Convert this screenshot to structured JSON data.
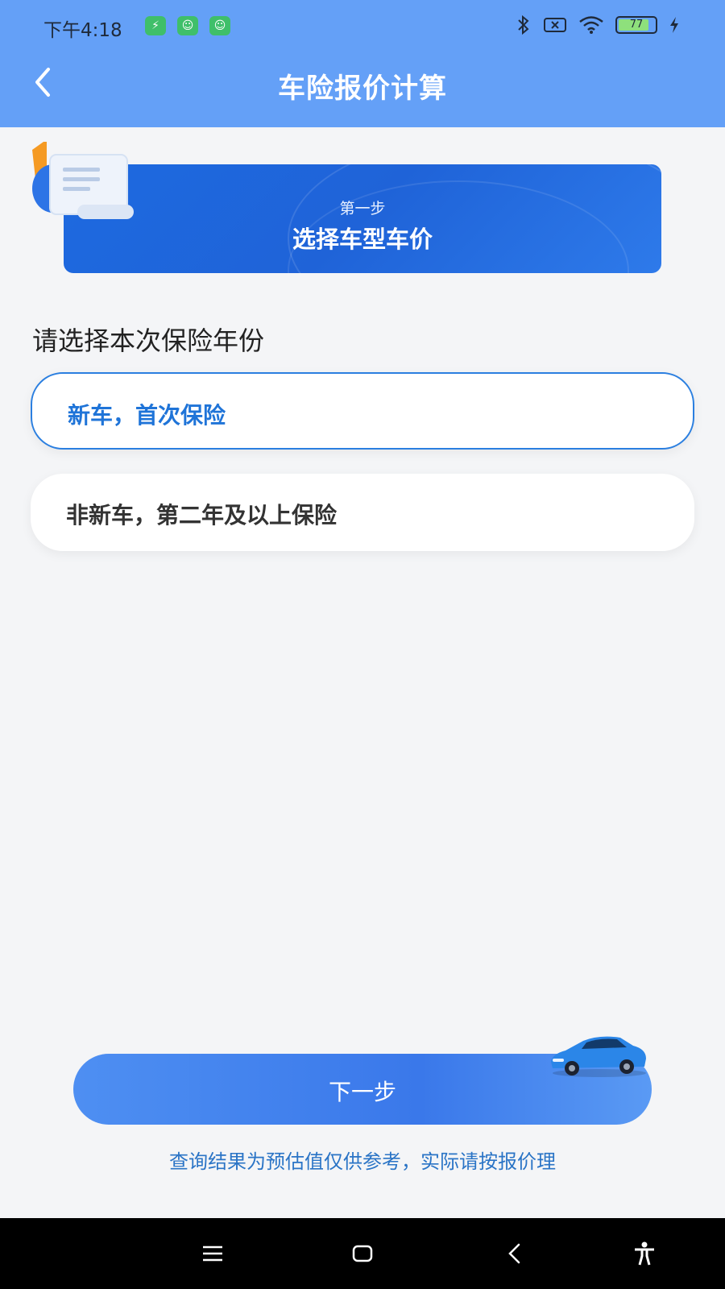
{
  "status_bar": {
    "time": "下午4:18",
    "battery": "77"
  },
  "header": {
    "title": "车险报价计算"
  },
  "step": {
    "label": "第一步",
    "title": "选择车型车价"
  },
  "question": "请选择本次保险年份",
  "options": [
    {
      "label": "新车，首次保险",
      "selected": true
    },
    {
      "label": "非新车，第二年及以上保险",
      "selected": false
    }
  ],
  "next_button": {
    "label": "下一步"
  },
  "note": "查询结果为预估值仅供参考，实际请按报价理",
  "colors": {
    "header": "#64a0f7",
    "accent": "#1f74d8",
    "step_card": "#1f63d8"
  }
}
